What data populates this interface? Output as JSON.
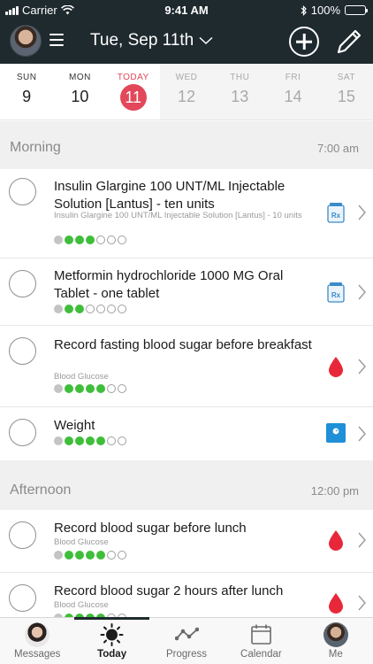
{
  "status_bar": {
    "carrier": "Carrier",
    "time": "9:41 AM",
    "battery": "100%"
  },
  "header": {
    "date_title": "Tue, Sep 11th"
  },
  "week": [
    {
      "name": "SUN",
      "num": "9",
      "state": "past"
    },
    {
      "name": "MON",
      "num": "10",
      "state": "past"
    },
    {
      "name": "TODAY",
      "num": "11",
      "state": "today"
    },
    {
      "name": "WED",
      "num": "12",
      "state": "future"
    },
    {
      "name": "THU",
      "num": "13",
      "state": "future"
    },
    {
      "name": "FRI",
      "num": "14",
      "state": "future"
    },
    {
      "name": "SAT",
      "num": "15",
      "state": "future"
    }
  ],
  "sections": {
    "morning": {
      "name": "Morning",
      "time": "7:00 am"
    },
    "afternoon": {
      "name": "Afternoon",
      "time": "12:00 pm"
    }
  },
  "tasks": [
    {
      "title": "Insulin Glargine 100 UNT/ML Injectable Solution [Lantus] - ten units",
      "subtitle": "Insulin Glargine 100 UNT/ML Injectable Solution [Lantus] - 10 units",
      "icon": "rx-icon",
      "streak": [
        "gray",
        "green",
        "green",
        "green",
        "empty",
        "empty",
        "empty"
      ]
    },
    {
      "title": "Metformin hydrochloride 1000 MG Oral Tablet - one tablet",
      "subtitle": "",
      "icon": "rx-icon",
      "streak": [
        "gray",
        "green",
        "green",
        "empty",
        "empty",
        "empty",
        "empty"
      ]
    },
    {
      "title": "Record fasting blood sugar before breakfast",
      "subtitle": "Blood Glucose",
      "icon": "blood-drop-icon",
      "streak": [
        "gray",
        "green",
        "green",
        "green",
        "green",
        "empty",
        "empty"
      ]
    },
    {
      "title": "Weight",
      "subtitle": "",
      "icon": "scale-icon",
      "streak": [
        "gray",
        "green",
        "green",
        "green",
        "green",
        "empty",
        "empty"
      ]
    },
    {
      "title": "Record blood sugar before lunch",
      "subtitle": "Blood Glucose",
      "icon": "blood-drop-icon",
      "streak": [
        "gray",
        "green",
        "green",
        "green",
        "green",
        "empty",
        "empty"
      ]
    },
    {
      "title": "Record blood sugar 2 hours after lunch",
      "subtitle": "Blood Glucose",
      "icon": "blood-drop-icon",
      "streak": [
        "gray",
        "green",
        "green",
        "green",
        "green",
        "empty",
        "empty"
      ]
    }
  ],
  "tabs": [
    {
      "label": "Messages",
      "icon": "avatar-f"
    },
    {
      "label": "Today",
      "icon": "sun-icon"
    },
    {
      "label": "Progress",
      "icon": "progress-icon"
    },
    {
      "label": "Calendar",
      "icon": "calendar-icon"
    },
    {
      "label": "Me",
      "icon": "avatar-m"
    }
  ],
  "colors": {
    "header_bg": "#1f2a2e",
    "today_accent": "#e2485a",
    "streak_green": "#3fbe3a",
    "drop_red": "#e8283a",
    "scale_blue": "#1f8fd8",
    "rx_blue": "#3a8bc8"
  }
}
